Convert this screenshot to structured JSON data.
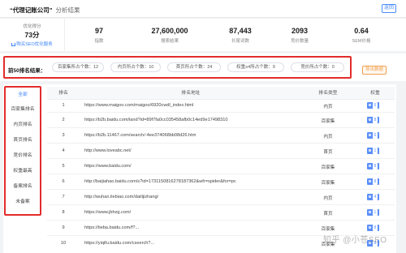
{
  "header": {
    "company": "“代理记账公司”",
    "subtitle": "分析结果",
    "return_label": "返回"
  },
  "score": {
    "label": "优化得分",
    "value": "73分",
    "link": "购买SEO优化服务"
  },
  "stats": [
    {
      "num": "97",
      "cap": "指数"
    },
    {
      "num": "27,600,000",
      "cap": "搜索结果"
    },
    {
      "num": "87,443",
      "cap": "长尾词数"
    },
    {
      "num": "2093",
      "cap": "竞价数量"
    },
    {
      "num": "0.64",
      "cap": "SEM价格"
    }
  ],
  "summary": {
    "title": "前50排名结果：",
    "pills": [
      "百家集所占个数：12",
      "内页所占个数：10",
      "首页所占个数：24",
      "权重≥4所占个数：9",
      "竞价所占个数：0"
    ],
    "export_label": "导出数据"
  },
  "sidebar": {
    "items": [
      "全部",
      "百家集排名",
      "内页排名",
      "首页排名",
      "竞价排名",
      "权重最高",
      "备案排名",
      "未备案"
    ],
    "active": 0
  },
  "table": {
    "headers": [
      "排名",
      "排名地址",
      "排名类型",
      "权重"
    ],
    "rows": [
      {
        "rank": "1",
        "url": "https://www.maigoo.com/maigoo/6920cwdl_index.html",
        "type": "内页",
        "weight": "6"
      },
      {
        "rank": "2",
        "url": "https://b2b.baidu.com/land?id=89f7fa0cc035458afb0c14ed9e17498310",
        "type": "百家集",
        "weight": "8"
      },
      {
        "rank": "3",
        "url": "https://b2b.11467.com/search/-4ee374068bb08d26.htm",
        "type": "内页",
        "weight": "6"
      },
      {
        "rank": "4",
        "url": "http://www.loveabc.net/",
        "type": "首页",
        "weight": "1"
      },
      {
        "rank": "5",
        "url": "https://www.baidu.com/",
        "type": "百家集",
        "weight": "8"
      },
      {
        "rank": "6",
        "url": "http://baijiahao.baidu.com/s?id=1731150816278187362&wfr=spider&for=pc",
        "type": "百家集",
        "weight": "8"
      },
      {
        "rank": "7",
        "url": "http://wuhan.liebiao.com/dailijizhang/",
        "type": "内页",
        "weight": "4"
      },
      {
        "rank": "8",
        "url": "https://www.jbhzg.com/",
        "type": "首页",
        "weight": "1"
      },
      {
        "rank": "9",
        "url": "https://tieba.baidu.com/f?...",
        "type": "百家集",
        "weight": "8"
      },
      {
        "rank": "10",
        "url": "https://yiqifu.baidu.com/cseerch?...",
        "type": "百家集",
        "weight": "8"
      }
    ]
  },
  "watermark": "知乎 @小苍SEO",
  "colors": {
    "accent": "#3b82f6",
    "highlight": "#e32c2c",
    "export": "#f29e4c",
    "badge": "#5b8ff9"
  }
}
